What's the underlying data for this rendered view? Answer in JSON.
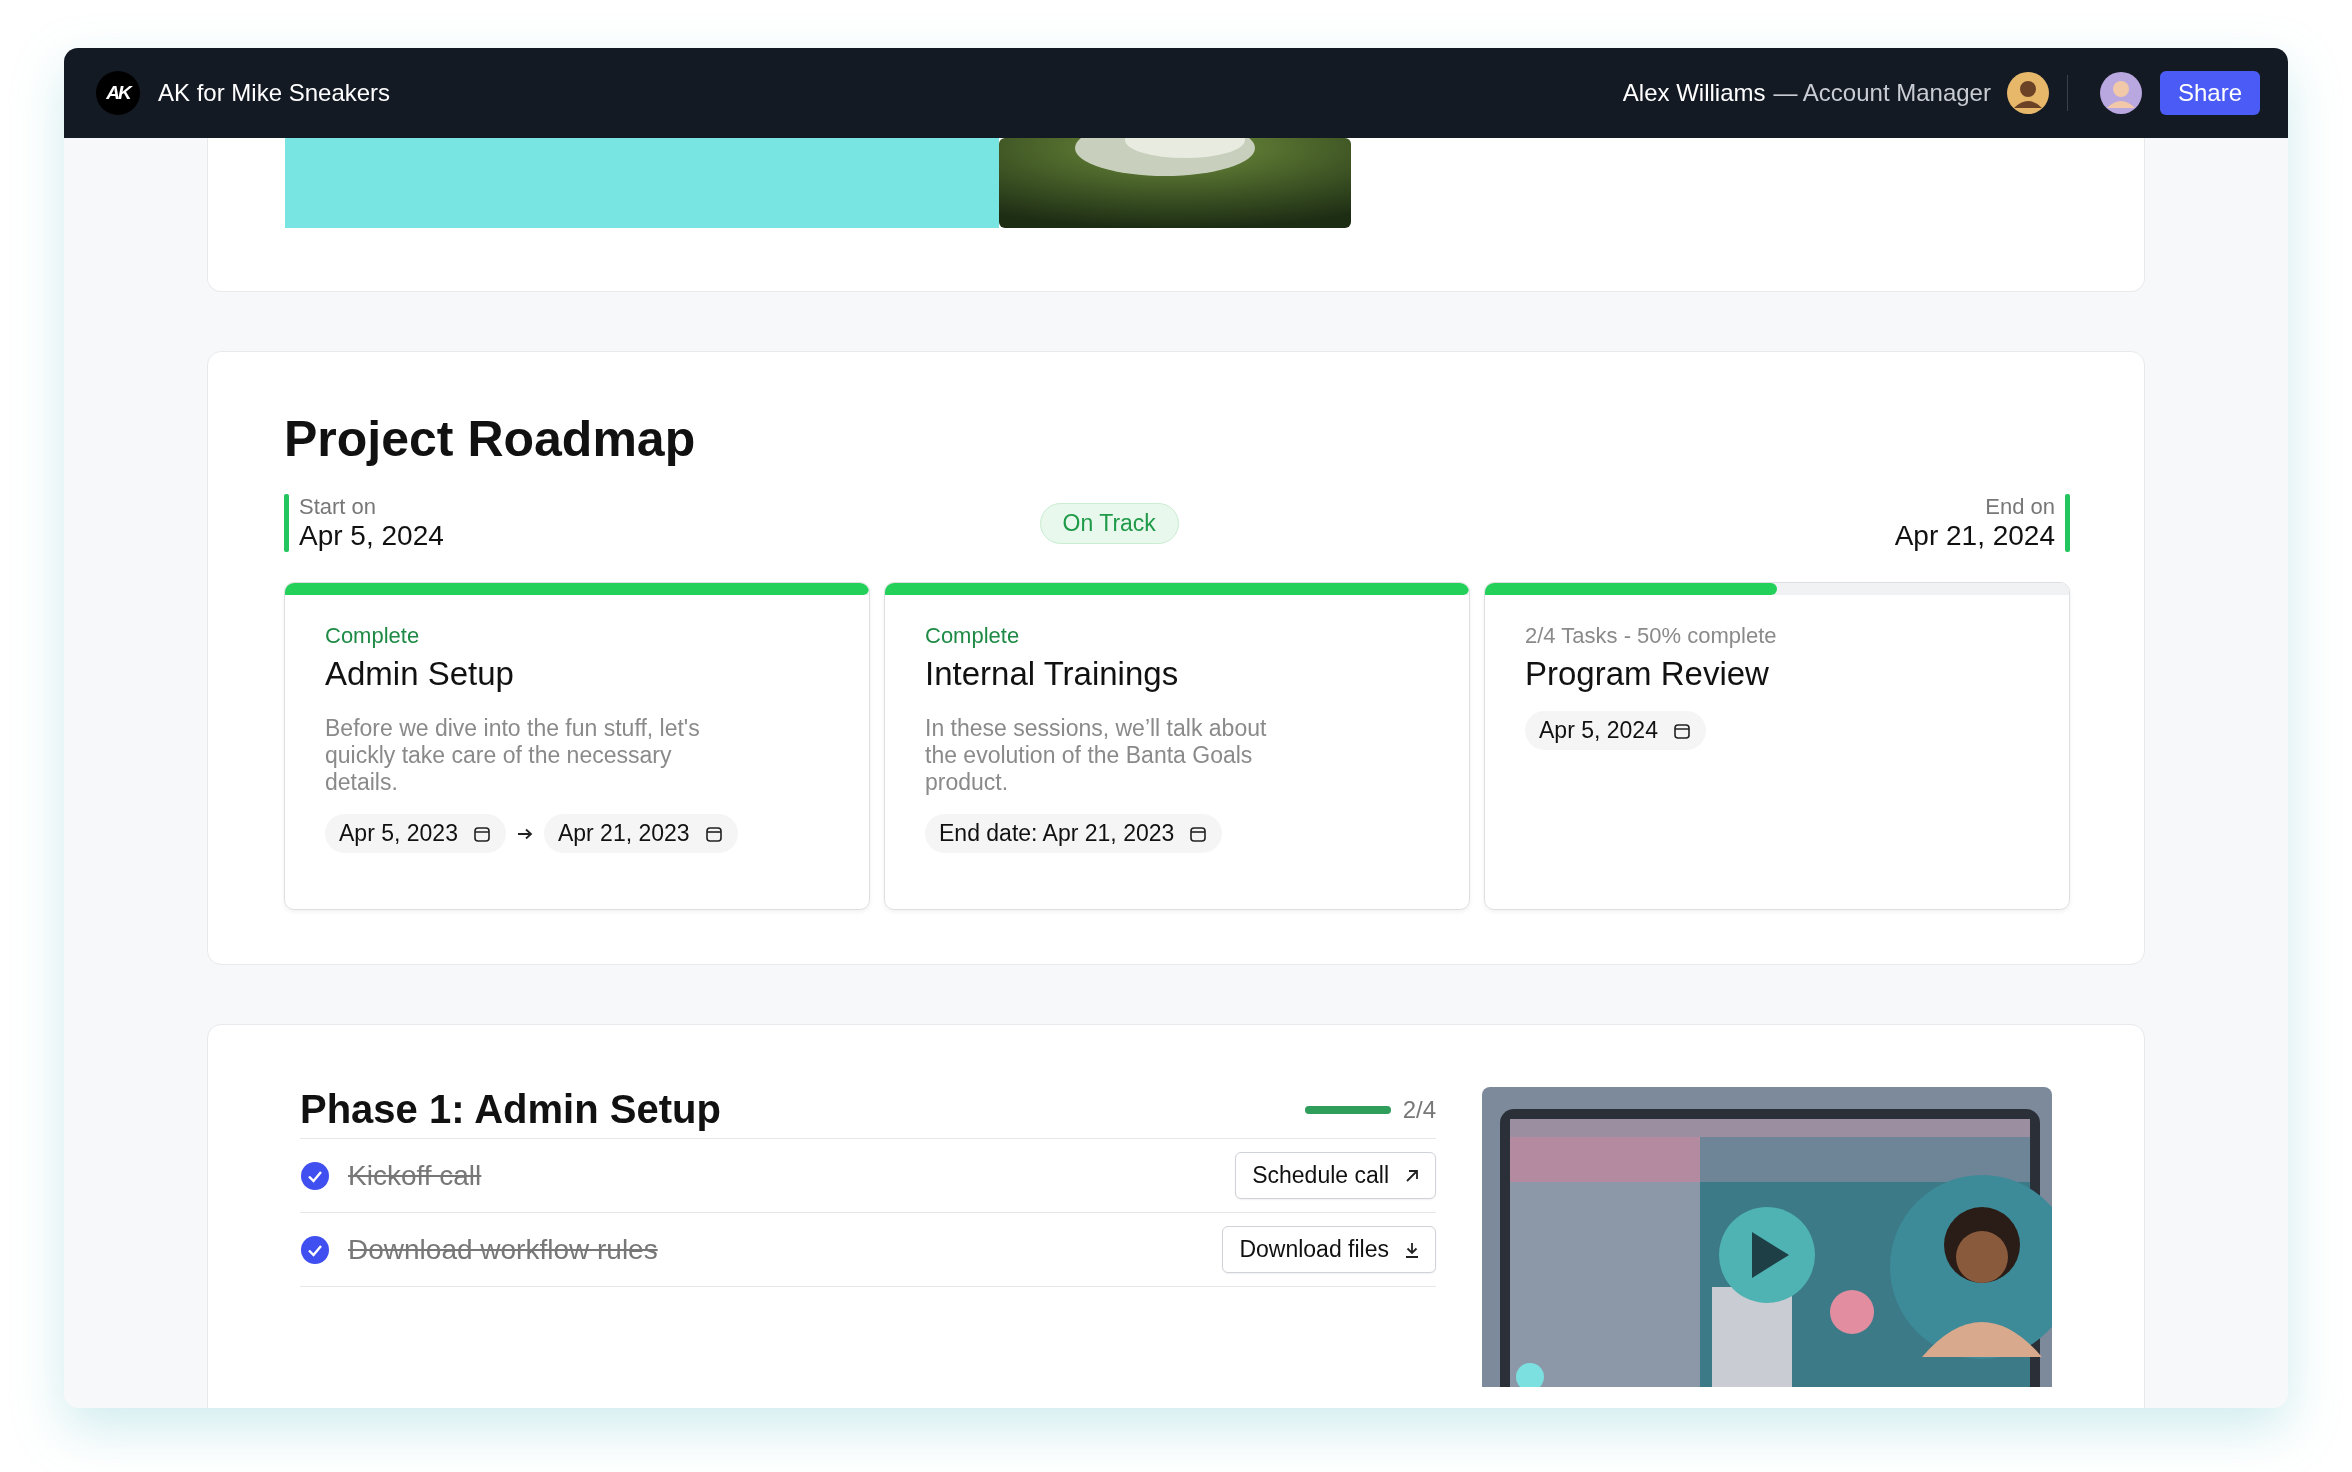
{
  "header": {
    "logo": "AK",
    "title": "AK for Mike Sneakers",
    "user_name": "Alex Williams",
    "user_role": "— Account Manager",
    "share_button": "Share"
  },
  "roadmap": {
    "title": "Project Roadmap",
    "start_label": "Start on",
    "start_date": "Apr 5, 2024",
    "status": "On Track",
    "end_label": "End on",
    "end_date": "Apr 21, 2024",
    "milestones": [
      {
        "status": "Complete",
        "complete": true,
        "level": 1,
        "title": "Admin Setup",
        "description": "Before we dive into the fun stuff, let's quickly take care of the necessary details.",
        "dates": [
          "Apr 5, 2023",
          "Apr 21, 2023"
        ]
      },
      {
        "status": "Complete",
        "complete": true,
        "level": 1,
        "title": "Internal Trainings",
        "description": "In these sessions, we’ll talk about the evolution of the Banta Goals product.",
        "dates": [
          "End date: Apr 21, 2023"
        ]
      },
      {
        "status": "2/4 Tasks - 50% complete",
        "complete": false,
        "level": 0.5,
        "title": "Program Review",
        "dates": [
          "Apr 5, 2024"
        ]
      }
    ]
  },
  "phase": {
    "title": "Phase 1: Admin Setup",
    "progress": {
      "level": 1,
      "reading": "2/4"
    },
    "tasks": [
      {
        "label": "Kickoff call",
        "checked": true,
        "action": "Schedule call",
        "kind": "link"
      },
      {
        "label": "Download workflow rules",
        "checked": true,
        "action": "Download files",
        "kind": "download"
      }
    ]
  }
}
